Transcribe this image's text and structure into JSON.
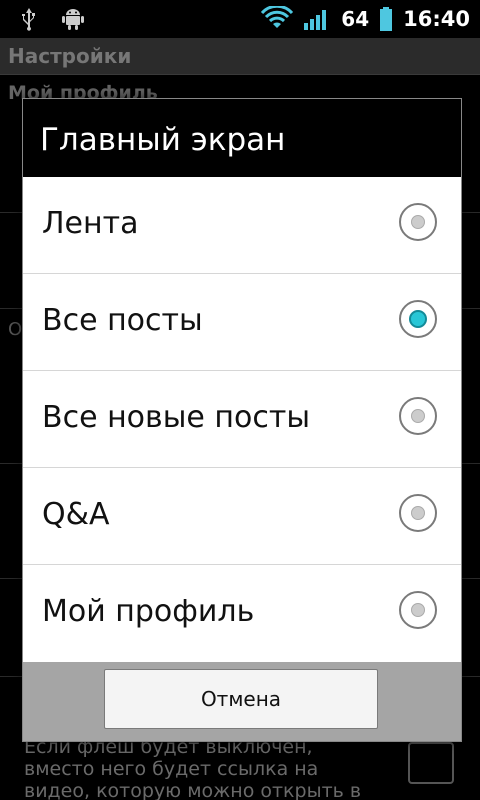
{
  "status_bar": {
    "icons": [
      "usb-icon",
      "android-debug-icon",
      "wifi-icon",
      "signal-icon",
      "battery-icon"
    ],
    "battery_level": "64",
    "time": "16:40"
  },
  "background": {
    "title": "Настройки",
    "section": "Мой профиль",
    "footer_text": "Если флеш будет выключен, вместо него будет ссылка на видео, которую можно открыть в плеере или"
  },
  "dialog": {
    "title": "Главный экран",
    "options": [
      {
        "label": "Лента",
        "checked": false
      },
      {
        "label": "Все посты",
        "checked": true
      },
      {
        "label": "Все новые посты",
        "checked": false
      },
      {
        "label": "Q&A",
        "checked": false
      },
      {
        "label": "Мой профиль",
        "checked": false
      }
    ],
    "cancel_label": "Отмена"
  },
  "colors": {
    "accent": "#28c6d6",
    "dialog_footer": "#a5a5a5"
  }
}
